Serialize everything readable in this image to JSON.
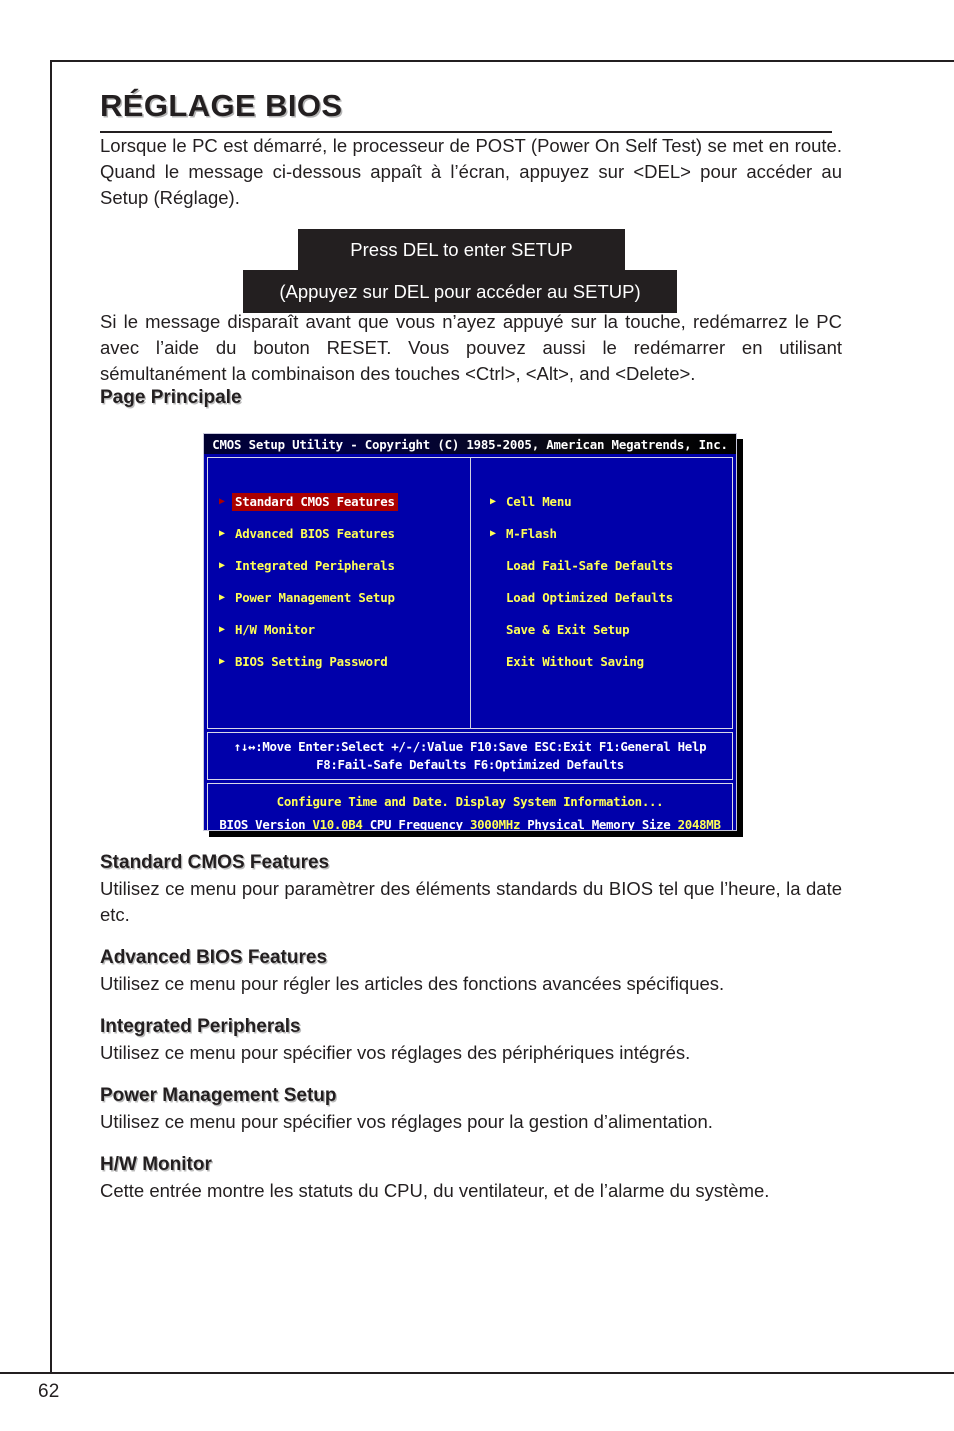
{
  "page": {
    "number": "62",
    "title": "RÉGLAGE BIOS"
  },
  "intro": {
    "paragraph_1": "Lorsque le PC est démarré, le processeur de POST (Power On Self Test) se met en route. Quand le message ci-dessous appaît à l’écran, appuyez sur <DEL> pour accéder au Setup (Réglage).",
    "message_box_en": "Press DEL to enter SETUP",
    "message_box_fr": "(Appuyez sur DEL pour accéder au SETUP)",
    "paragraph_2": "Si le message disparaît avant que vous n’ayez appuyé sur la touche, redémarrez le PC avec l’aide du bouton RESET. Vous pouvez aussi le redémarrer en utilisant sémultanément la combinaison des touches <Ctrl>, <Alt>, and <Delete>."
  },
  "main_page_heading": "Page Principale",
  "bios": {
    "titlebar": "CMOS Setup Utility - Copyright (C) 1985-2005, American Megatrends, Inc.",
    "left_menu": [
      {
        "label": "Standard CMOS Features",
        "arrow": "▶",
        "selected": true
      },
      {
        "label": "Advanced BIOS Features",
        "arrow": "▶",
        "selected": false
      },
      {
        "label": "Integrated Peripherals",
        "arrow": "▶",
        "selected": false
      },
      {
        "label": "Power Management Setup",
        "arrow": "▶",
        "selected": false
      },
      {
        "label": "H/W Monitor",
        "arrow": "▶",
        "selected": false
      },
      {
        "label": "BIOS Setting Password",
        "arrow": "▶",
        "selected": false
      }
    ],
    "right_menu": [
      {
        "label": "Cell Menu",
        "arrow": "▶",
        "selected": false
      },
      {
        "label": "M-Flash",
        "arrow": "▶",
        "selected": false
      },
      {
        "label": "Load Fail-Safe Defaults",
        "arrow": "",
        "selected": false
      },
      {
        "label": "Load Optimized Defaults",
        "arrow": "",
        "selected": false
      },
      {
        "label": "Save & Exit Setup",
        "arrow": "",
        "selected": false
      },
      {
        "label": "Exit Without Saving",
        "arrow": "",
        "selected": false
      }
    ],
    "help_line_1": "↑↓↔:Move  Enter:Select  +/-/:Value  F10:Save  ESC:Exit  F1:General Help",
    "help_line_2": "F8:Fail-Safe Defaults   F6:Optimized Defaults",
    "info_line_1": "Configure Time and Date.  Display System Information...",
    "info_version_label_1": "BIOS Version ",
    "info_version_value_1": "V10.0B4",
    "info_version_label_2": " CPU Frequency ",
    "info_version_value_2": "3000MHz",
    "info_version_label_3": " Physical Memory Size ",
    "info_version_value_3": "2048MB",
    "colors": {
      "background": "#0000aa",
      "highlight": "#aa0000",
      "text": "#ffff55",
      "border": "#d8d8e8"
    }
  },
  "descriptions": [
    {
      "heading": "Standard CMOS Features",
      "text": "Utilisez ce menu pour paramètrer des éléments standards du BIOS tel que l’heure, la date etc."
    },
    {
      "heading": "Advanced BIOS Features",
      "text": "Utilisez ce menu pour régler les articles des fonctions avancées spécifiques."
    },
    {
      "heading": "Integrated Peripherals",
      "text": "Utilisez ce menu pour spécifier vos réglages des périphériques intégrés."
    },
    {
      "heading": "Power Management Setup",
      "text": "Utilisez ce menu pour spécifier vos réglages pour la gestion d’alimentation."
    },
    {
      "heading": "H/W Monitor",
      "text": "Cette entrée montre les statuts du CPU, du ventilateur, et de l’alarme du système."
    }
  ]
}
